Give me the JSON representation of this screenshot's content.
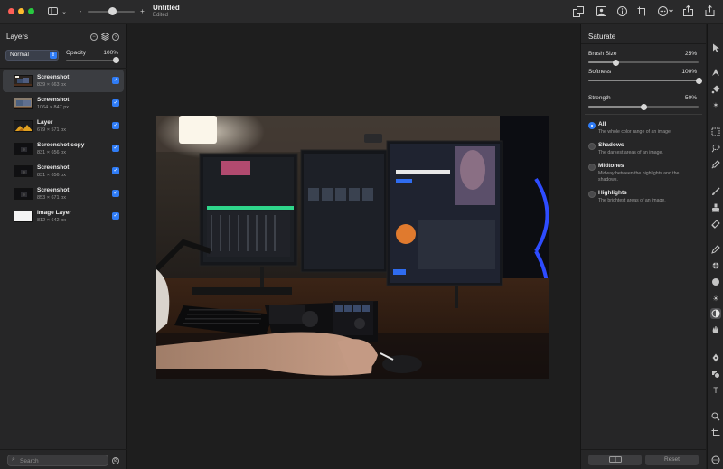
{
  "window": {
    "title": "Untitled",
    "subtitle": "Edited"
  },
  "layers_panel": {
    "title": "Layers",
    "blend_mode": "Normal",
    "opacity_label": "Opacity",
    "opacity_value": "100%",
    "opacity_level": 1.0,
    "layers": [
      {
        "name": "Screenshot",
        "size": "839 × 663 px",
        "visible": true,
        "selected": true,
        "thumb": "photo"
      },
      {
        "name": "Screenshot",
        "size": "1064 × 847 px",
        "visible": true,
        "selected": false,
        "thumb": "photo-light"
      },
      {
        "name": "Layer",
        "size": "679 × 571 px",
        "visible": true,
        "selected": false,
        "thumb": "mountain"
      },
      {
        "name": "Screenshot copy",
        "size": "831 × 656 px",
        "visible": true,
        "selected": false,
        "thumb": "dark"
      },
      {
        "name": "Screenshot",
        "size": "831 × 656 px",
        "visible": true,
        "selected": false,
        "thumb": "dark"
      },
      {
        "name": "Screenshot",
        "size": "853 × 671 px",
        "visible": true,
        "selected": false,
        "thumb": "dark"
      },
      {
        "name": "Image Layer",
        "size": "812 × 642 px",
        "visible": true,
        "selected": false,
        "thumb": "white"
      }
    ],
    "search_placeholder": "Search"
  },
  "adjust_panel": {
    "title": "Saturate",
    "brush_size_label": "Brush Size",
    "brush_size_value": "25%",
    "brush_size_level": 0.25,
    "softness_label": "Softness",
    "softness_value": "100%",
    "softness_level": 1.0,
    "strength_label": "Strength",
    "strength_value": "50%",
    "strength_level": 0.5,
    "ranges": [
      {
        "title": "All",
        "desc": "The whole color range of an image.",
        "selected": true
      },
      {
        "title": "Shadows",
        "desc": "The darkest areas of an image.",
        "selected": false
      },
      {
        "title": "Midtones",
        "desc": "Midway between the highlights and the shadows.",
        "selected": false
      },
      {
        "title": "Highlights",
        "desc": "The brightest areas of an image.",
        "selected": false
      }
    ],
    "reset_label": "Reset"
  },
  "colors": {
    "accent": "#2f7cf6",
    "panel_bg": "#262627",
    "canvas_bg": "#1e1e1e"
  },
  "tools": [
    "pointer-icon",
    "shape-icon",
    "paint-bucket-icon",
    "magic-wand-icon",
    "rectangle-select-icon",
    "lasso-icon",
    "eyedropper-icon",
    "brush-icon",
    "stamp-icon",
    "eraser-icon",
    "pencil-icon",
    "retouch-icon",
    "blur-icon",
    "sharpen-icon",
    "burn-icon",
    "saturate-icon",
    "smudge-icon",
    "pen-icon",
    "shapes-icon",
    "text-icon",
    "zoom-icon",
    "crop-icon",
    "more-icon"
  ]
}
